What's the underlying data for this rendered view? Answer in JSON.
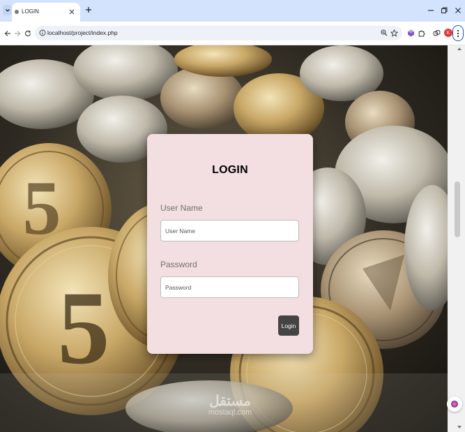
{
  "browser": {
    "tab": {
      "title": "LOGIN"
    },
    "address_bar": {
      "url": "localhost/project/index.php"
    },
    "profile_initial": "K",
    "accent_color": "#0b57d0"
  },
  "page": {
    "background": "photo of stacked gold coins",
    "form": {
      "title": "LOGIN",
      "username": {
        "label": "User Name",
        "placeholder": "User Name",
        "value": ""
      },
      "password": {
        "label": "Password",
        "placeholder": "Password",
        "value": ""
      },
      "submit_label": "Login",
      "card_color": "#f3dfe1",
      "button_color": "#444444"
    },
    "watermark": {
      "arabic": "مستقل",
      "latin": "mostaql.com"
    }
  }
}
